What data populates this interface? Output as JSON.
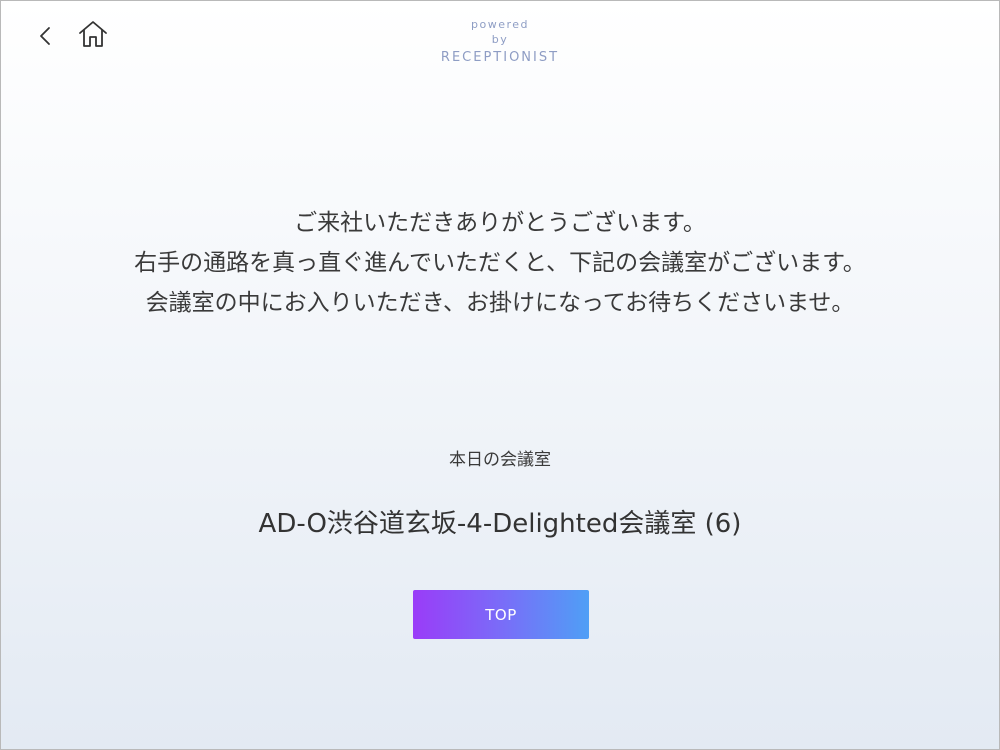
{
  "header": {
    "back_icon": "chevron-left-icon",
    "home_icon": "home-icon",
    "brand": {
      "line1": "powered",
      "line2": "by",
      "name": "RECEPTIONIST"
    }
  },
  "main": {
    "message_lines": [
      "ご来社いただきありがとうございます。",
      "右手の通路を真っ直ぐ進んでいただくと、下記の会議室がございます。",
      "会議室の中にお入りいただき、お掛けになってお待ちくださいませ。"
    ],
    "room_heading": "本日の会議室",
    "room_name": "AD-O渋谷道玄坂-4-Delighted会議室 (6)",
    "top_button_label": "TOP"
  },
  "colors": {
    "brand_text": "#8e9dc4",
    "button_gradient_start": "#9a3cf8",
    "button_gradient_end": "#4f9ff6",
    "body_text": "#3a3a3a",
    "icon_stroke": "#333333"
  }
}
